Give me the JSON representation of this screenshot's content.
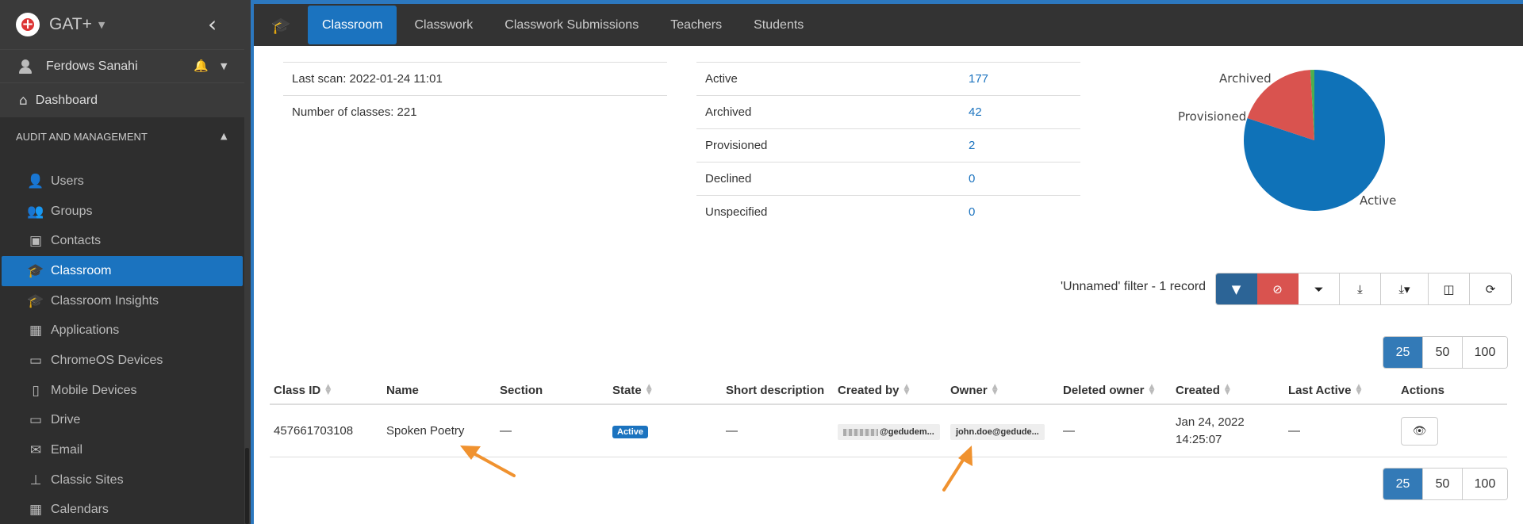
{
  "app": {
    "title": "GAT+"
  },
  "user": {
    "name": "Ferdows Sanahi"
  },
  "sidebar": {
    "dashboard": "Dashboard",
    "section": "AUDIT AND MANAGEMENT",
    "items": [
      {
        "label": "Users",
        "icon": "user-icon"
      },
      {
        "label": "Groups",
        "icon": "users-icon"
      },
      {
        "label": "Contacts",
        "icon": "contact-icon"
      },
      {
        "label": "Classroom",
        "icon": "graduation-cap-icon"
      },
      {
        "label": "Classroom Insights",
        "icon": "classroom-insights-icon"
      },
      {
        "label": "Applications",
        "icon": "grid-icon"
      },
      {
        "label": "ChromeOS Devices",
        "icon": "laptop-icon"
      },
      {
        "label": "Mobile Devices",
        "icon": "mobile-icon"
      },
      {
        "label": "Drive",
        "icon": "drive-icon"
      },
      {
        "label": "Email",
        "icon": "envelope-icon"
      },
      {
        "label": "Classic Sites",
        "icon": "sitemap-icon"
      },
      {
        "label": "Calendars",
        "icon": "calendar-icon"
      }
    ]
  },
  "tabs": [
    "Classroom",
    "Classwork",
    "Classwork Submissions",
    "Teachers",
    "Students"
  ],
  "info": {
    "last_scan": "Last scan: 2022-01-24 11:01",
    "num_classes": "Number of classes: 221"
  },
  "stats": [
    {
      "label": "Active",
      "value": "177"
    },
    {
      "label": "Archived",
      "value": "42"
    },
    {
      "label": "Provisioned",
      "value": "2"
    },
    {
      "label": "Declined",
      "value": "0"
    },
    {
      "label": "Unspecified",
      "value": "0"
    }
  ],
  "chart_data": {
    "type": "pie",
    "categories": [
      "Active",
      "Archived",
      "Provisioned"
    ],
    "values": [
      177,
      42,
      2
    ],
    "colors": [
      "#0f72b8",
      "#d9534f",
      "#4caf50"
    ]
  },
  "filter": {
    "text": "'Unnamed' filter -  1 record"
  },
  "pager": [
    "25",
    "50",
    "100"
  ],
  "table": {
    "columns": [
      "Class ID",
      "Name",
      "Section",
      "State",
      "Short description",
      "Created by",
      "Owner",
      "Deleted owner",
      "Created",
      "Last Active",
      "Actions"
    ],
    "rows": [
      {
        "class_id": "457661703108",
        "name": "Spoken Poetry",
        "section": "—",
        "state": "Active",
        "short_description": "—",
        "created_by": "@gedudem...",
        "owner": "john.doe@gedude...",
        "deleted_owner": "—",
        "created_date": "Jan 24, 2022",
        "created_time": "14:25:07",
        "last_active": "—"
      }
    ]
  },
  "colors": {
    "accent": "#1b73bf",
    "arrow": "#f0922f"
  }
}
